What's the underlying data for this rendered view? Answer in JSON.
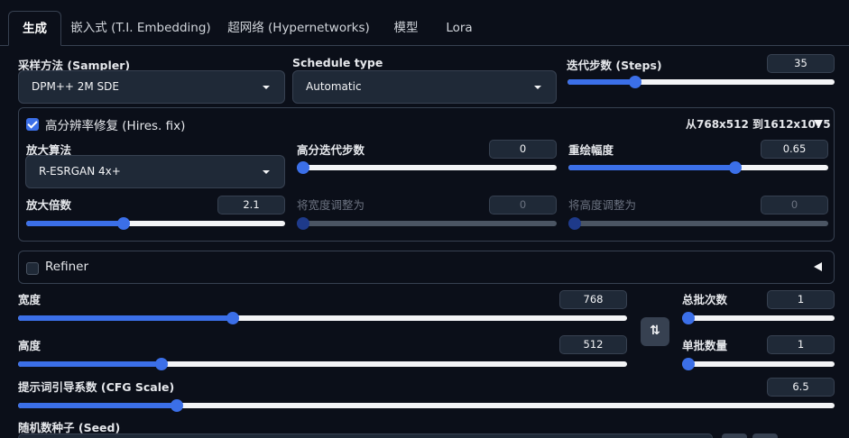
{
  "tabs": [
    {
      "label": "生成",
      "active": true
    },
    {
      "label": "嵌入式 (T.I. Embedding)",
      "active": false
    },
    {
      "label": "超网络 (Hypernetworks)",
      "active": false
    },
    {
      "label": "模型",
      "active": false
    },
    {
      "label": "Lora",
      "active": false
    }
  ],
  "sampler": {
    "label": "采样方法 (Sampler)",
    "value": "DPM++ 2M SDE"
  },
  "schedule": {
    "label": "Schedule type",
    "value": "Automatic"
  },
  "steps": {
    "label": "迭代步数 (Steps)",
    "value": "35",
    "fraction": 0.24
  },
  "hires": {
    "label": "高分辨率修复 (Hires. fix)",
    "checked": true,
    "summary": "从768x512 到1612x1075",
    "upscaler": {
      "label": "放大算法",
      "value": "R-ESRGAN 4x+"
    },
    "hires_steps": {
      "label": "高分迭代步数",
      "value": "0",
      "fraction": 0.0
    },
    "denoise": {
      "label": "重绘幅度",
      "value": "0.65",
      "fraction": 0.65
    },
    "scale": {
      "label": "放大倍数",
      "value": "2.1",
      "fraction": 0.37
    },
    "resize_w": {
      "label": "将宽度调整为",
      "value": "0",
      "fraction": 0.0
    },
    "resize_h": {
      "label": "将高度调整为",
      "value": "0",
      "fraction": 0.0
    }
  },
  "refiner": {
    "label": "Refiner",
    "checked": false
  },
  "width": {
    "label": "宽度",
    "value": "768",
    "fraction": 0.35
  },
  "height": {
    "label": "高度",
    "value": "512",
    "fraction": 0.23
  },
  "swap_icon": "swap-vertical-icon",
  "swap_glyph": "⇅",
  "batch_count": {
    "label": "总批次数",
    "value": "1",
    "fraction": 0.0
  },
  "batch_size": {
    "label": "单批数量",
    "value": "1",
    "fraction": 0.0
  },
  "cfg": {
    "label": "提示词引导系数 (CFG Scale)",
    "value": "6.5",
    "fraction": 0.19
  },
  "seed": {
    "label": "随机数种子 (Seed)"
  },
  "colors": {
    "accent": "#3b6fe8",
    "background": "#0b0f19",
    "input": "#1f2937"
  }
}
